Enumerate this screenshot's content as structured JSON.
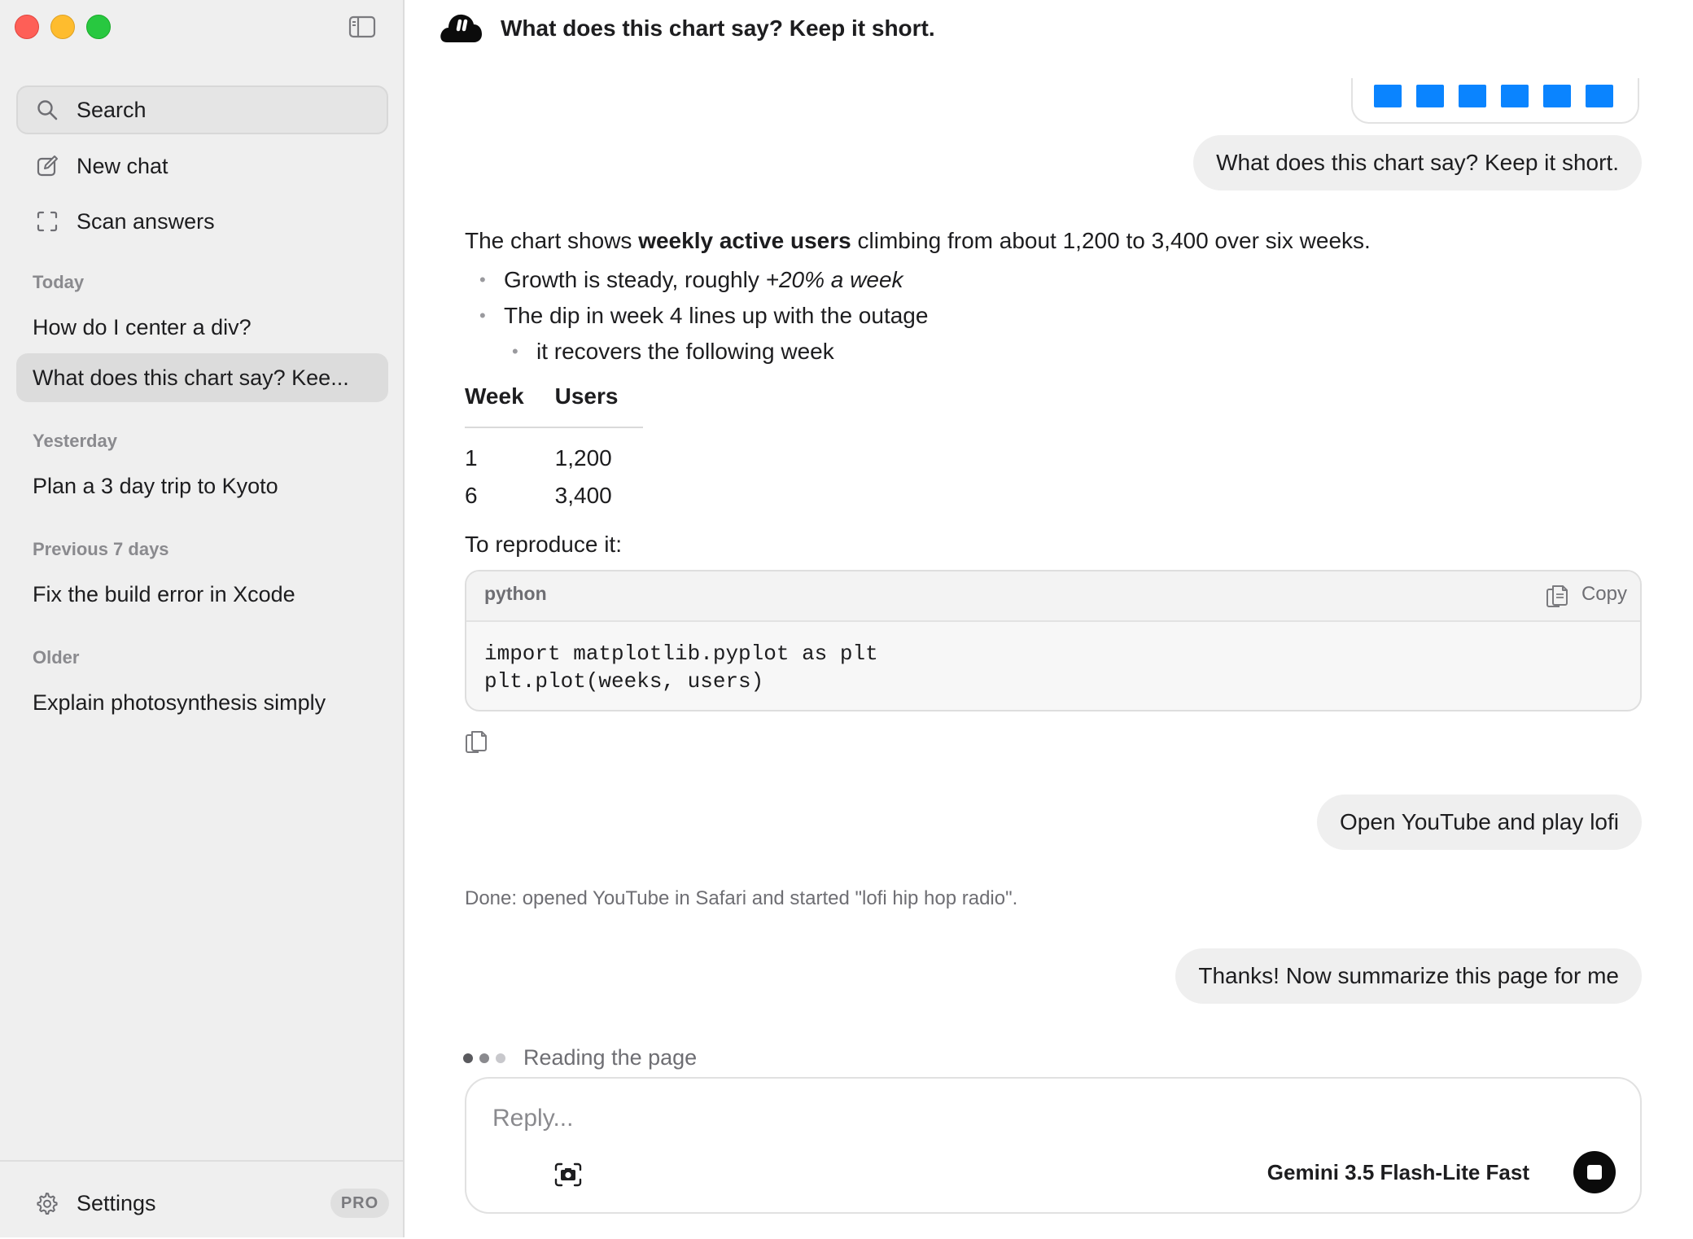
{
  "sidebar": {
    "search_label": "Search",
    "new_chat_label": "New chat",
    "scan_label": "Scan answers",
    "sections": {
      "today": "Today",
      "yesterday": "Yesterday",
      "previous7": "Previous 7 days",
      "older": "Older"
    },
    "conversations": {
      "c1": "How do I center a div?",
      "c2": "What does this chart say? Kee...",
      "c3": "Plan a 3 day trip to Kyoto",
      "c4": "Fix the build error in Xcode",
      "c5": "Explain photosynthesis simply"
    },
    "settings_label": "Settings",
    "pro_badge": "PRO"
  },
  "header": {
    "title": "What does this chart say? Keep it short."
  },
  "messages": {
    "user1": "What does this chart say? Keep it short.",
    "answer": {
      "intro_before": "The chart shows ",
      "intro_bold": "weekly active users",
      "intro_after": " climbing from about 1,200 to 3,400 over six weeks.",
      "b1_text": "Growth is steady, roughly ",
      "b1_italic": "+20% a week",
      "b2": "The dip in week 4 lines up with the outage",
      "b2_sub": "it recovers the following week",
      "table": {
        "h1": "Week",
        "h2": "Users",
        "r1c1": "1",
        "r1c2": "1,200",
        "r2c1": "6",
        "r2c2": "3,400"
      },
      "repro": "To reproduce it:",
      "code": {
        "lang": "python",
        "copy_label": "Copy",
        "text": "import matplotlib.pyplot as plt\nplt.plot(weeks, users)"
      }
    },
    "user2": "Open YouTube and play lofi",
    "status": "Done: opened YouTube in Safari and started \"lofi hip hop radio\".",
    "user3": "Thanks! Now summarize this page for me",
    "thinking": "Reading the page"
  },
  "composer": {
    "placeholder": "Reply...",
    "model": "Gemini 3.5 Flash-Lite Fast"
  },
  "colors": {
    "accent": "#0a84ff",
    "sidebar_bg": "#efefef",
    "bubble_bg": "#efefef"
  },
  "icons": [
    "sidebar-toggle-icon",
    "search-icon",
    "compose-icon",
    "scan-icon",
    "gear-icon",
    "app-logo-icon",
    "copy-icon",
    "camera-icon",
    "stop-icon"
  ]
}
